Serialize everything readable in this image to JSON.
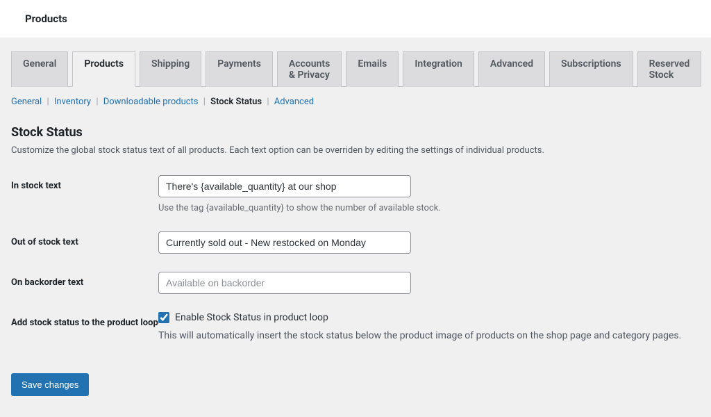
{
  "header": {
    "title": "Products"
  },
  "tabs": [
    {
      "label": "General",
      "active": false
    },
    {
      "label": "Products",
      "active": true
    },
    {
      "label": "Shipping",
      "active": false
    },
    {
      "label": "Payments",
      "active": false
    },
    {
      "label": "Accounts & Privacy",
      "active": false
    },
    {
      "label": "Emails",
      "active": false
    },
    {
      "label": "Integration",
      "active": false
    },
    {
      "label": "Advanced",
      "active": false
    },
    {
      "label": "Subscriptions",
      "active": false
    },
    {
      "label": "Reserved Stock",
      "active": false
    }
  ],
  "subtabs": [
    {
      "label": "General",
      "active": false
    },
    {
      "label": "Inventory",
      "active": false
    },
    {
      "label": "Downloadable products",
      "active": false
    },
    {
      "label": "Stock Status",
      "active": true
    },
    {
      "label": "Advanced",
      "active": false
    }
  ],
  "section": {
    "title": "Stock Status",
    "description": "Customize the global stock status text of all products. Each text option can be overriden by editing the settings of individual products."
  },
  "fields": {
    "in_stock": {
      "label": "In stock text",
      "value": "There's {available_quantity} at our shop",
      "help": "Use the tag {available_quantity} to show the number of available stock."
    },
    "out_of_stock": {
      "label": "Out of stock text",
      "value": "Currently sold out - New restocked on Monday"
    },
    "on_backorder": {
      "label": "On backorder text",
      "placeholder": "Available on backorder",
      "value": ""
    },
    "product_loop": {
      "label": "Add stock status to the product loop",
      "checkbox_label": "Enable Stock Status in product loop",
      "checked": true,
      "description": "This will automatically insert the stock status below the product image of products on the shop page and category pages."
    }
  },
  "buttons": {
    "save": "Save changes"
  }
}
